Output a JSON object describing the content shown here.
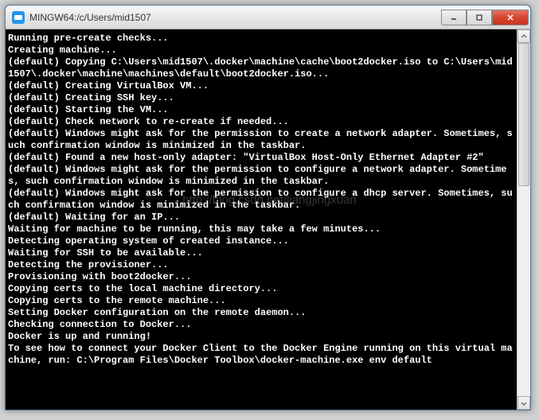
{
  "window": {
    "title": "MINGW64:/c/Users/mid1507"
  },
  "terminal": {
    "content": "Running pre-create checks...\nCreating machine...\n(default) Copying C:\\Users\\mid1507\\.docker\\machine\\cache\\boot2docker.iso to C:\\Users\\mid1507\\.docker\\machine\\machines\\default\\boot2docker.iso...\n(default) Creating VirtualBox VM...\n(default) Creating SSH key...\n(default) Starting the VM...\n(default) Check network to re-create if needed...\n(default) Windows might ask for the permission to create a network adapter. Sometimes, such confirmation window is minimized in the taskbar.\n(default) Found a new host-only adapter: \"VirtualBox Host-Only Ethernet Adapter #2\"\n(default) Windows might ask for the permission to configure a network adapter. Sometimes, such confirmation window is minimized in the taskbar.\n(default) Windows might ask for the permission to configure a dhcp server. Sometimes, such confirmation window is minimized in the taskbar.\n(default) Waiting for an IP...\nWaiting for machine to be running, this may take a few minutes...\nDetecting operating system of created instance...\nWaiting for SSH to be available...\nDetecting the provisioner...\nProvisioning with boot2docker...\nCopying certs to the local machine directory...\nCopying certs to the remote machine...\nSetting Docker configuration on the remote daemon...\nChecking connection to Docker...\nDocker is up and running!\nTo see how to connect your Docker Client to the Docker Engine running on this virtual machine, run: C:\\Program Files\\Docker Toolbox\\docker-machine.exe env default"
  },
  "watermark": "http://blog.csdn.net/liangjingxuan"
}
